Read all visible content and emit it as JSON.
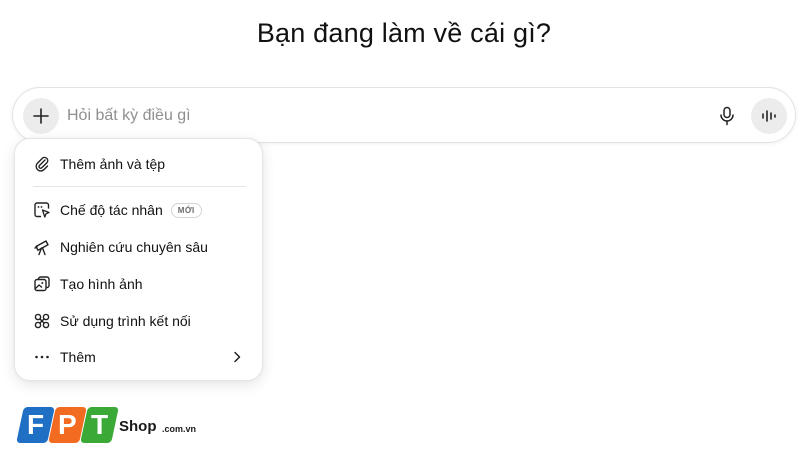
{
  "headline": "Bạn đang làm về cái gì?",
  "composer": {
    "placeholder": "Hỏi bất kỳ điều gì",
    "add_icon": "plus-icon",
    "mic_icon": "microphone-icon",
    "voice_icon": "voice-waveform-icon"
  },
  "menu": {
    "items": [
      {
        "label": "Thêm ảnh và tệp",
        "icon": "paperclip-icon"
      },
      {
        "label": "Chế độ tác nhân",
        "icon": "agent-cursor-icon",
        "badge": "MỚI"
      },
      {
        "label": "Nghiên cứu chuyên sâu",
        "icon": "telescope-icon"
      },
      {
        "label": "Tạo hình ảnh",
        "icon": "image-icon"
      },
      {
        "label": "Sử dụng trình kết nối",
        "icon": "connector-icon"
      },
      {
        "label": "Thêm",
        "icon": "ellipsis-icon",
        "submenu_icon": "chevron-right-icon"
      }
    ]
  },
  "watermark": {
    "tiles": [
      "F",
      "P",
      "T"
    ],
    "shop": "Shop",
    "domain": ".com.vn",
    "colors": {
      "f": "#1f6fc5",
      "p": "#f26b21",
      "t": "#3aa935"
    }
  }
}
